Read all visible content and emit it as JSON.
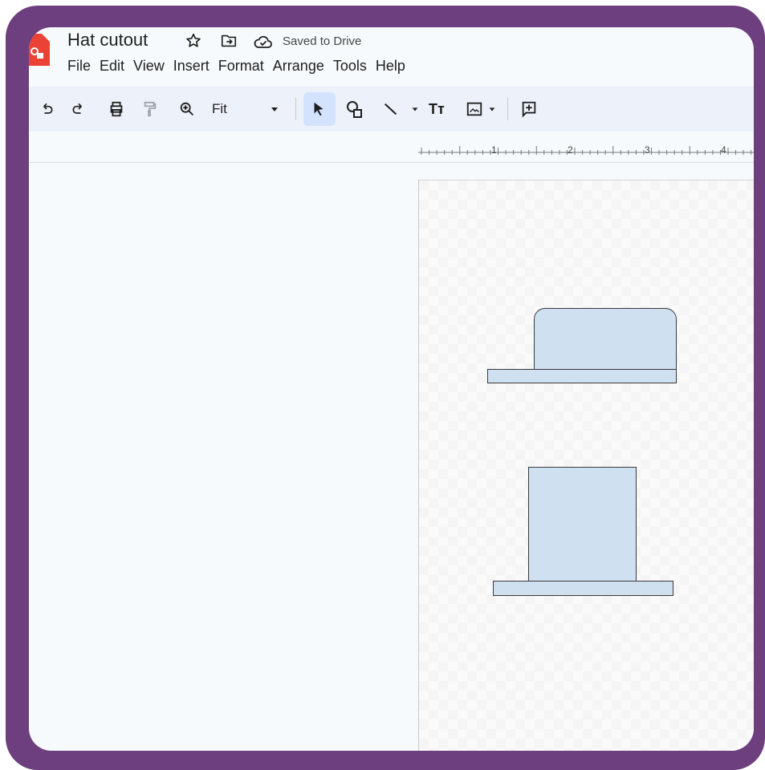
{
  "document": {
    "title": "Hat cutout",
    "save_status": "Saved to Drive"
  },
  "menu": [
    "File",
    "Edit",
    "View",
    "Insert",
    "Format",
    "Arrange",
    "Tools",
    "Help"
  ],
  "toolbar": {
    "zoom_label": "Fit",
    "text_tool_label": "Tт",
    "icons": [
      "undo-icon",
      "redo-icon",
      "print-icon",
      "paint-format-icon",
      "zoom-icon",
      "dropdown-arrow-icon",
      "select-cursor-icon",
      "shape-icon",
      "line-icon",
      "text-box-icon",
      "image-icon",
      "comment-add-icon"
    ]
  },
  "ruler": {
    "labels": [
      "1",
      "2",
      "3",
      "4"
    ]
  },
  "colors": {
    "frame": "#6e3f7e",
    "shape_fill": "#cfe0f1",
    "toolbar_bg": "#edf2fa",
    "selected_tool_bg": "#d3e3fd"
  }
}
